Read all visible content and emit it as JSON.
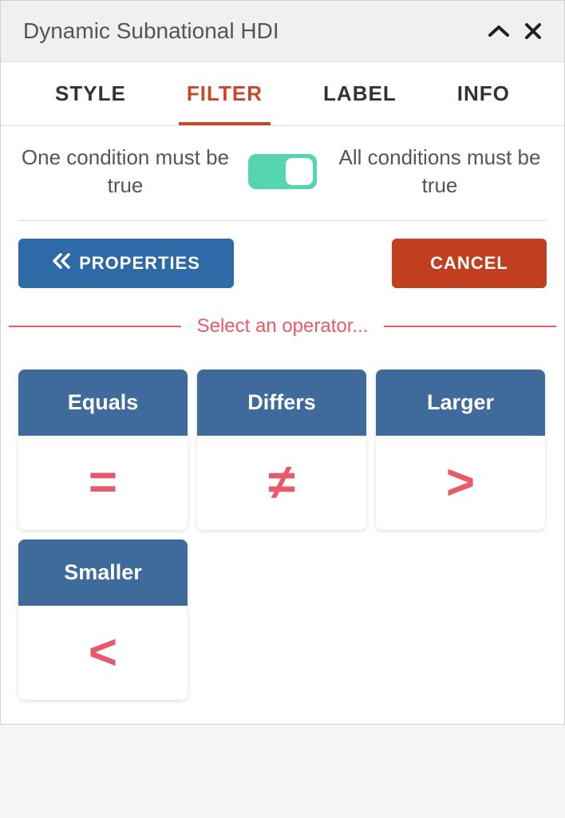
{
  "header": {
    "title": "Dynamic Subnational HDI"
  },
  "tabs": [
    {
      "id": "style",
      "label": "STYLE",
      "active": false
    },
    {
      "id": "filter",
      "label": "FILTER",
      "active": true
    },
    {
      "id": "label",
      "label": "LABEL",
      "active": false
    },
    {
      "id": "info",
      "label": "INFO",
      "active": false
    }
  ],
  "condition": {
    "left_label": "One condition must be true",
    "right_label": "All conditions must be true",
    "toggle_state": "right"
  },
  "buttons": {
    "properties": "PROPERTIES",
    "cancel": "CANCEL"
  },
  "operator_prompt": "Select an operator...",
  "operators": [
    {
      "id": "equals",
      "label": "Equals",
      "symbol": "="
    },
    {
      "id": "differs",
      "label": "Differs",
      "symbol": "≠"
    },
    {
      "id": "larger",
      "label": "Larger",
      "symbol": ">"
    },
    {
      "id": "smaller",
      "label": "Smaller",
      "symbol": "<"
    }
  ]
}
